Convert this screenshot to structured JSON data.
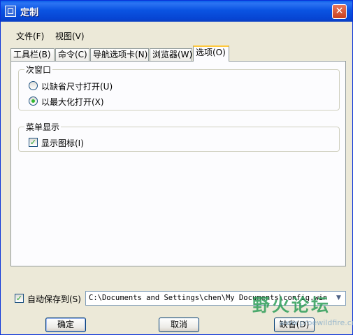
{
  "window": {
    "title": "定制",
    "close_label": "✕"
  },
  "menu": [
    "文件(F)",
    "视图(V)"
  ],
  "tabs": [
    "工具栏(B)",
    "命令(C)",
    "导航选项卡(N)",
    "浏览器(W)",
    "选项(O)"
  ],
  "active_tab": "选项(O)",
  "group_window": {
    "legend": "次窗口",
    "options": [
      "以缺省尺寸打开(U)",
      "以最大化打开(X)"
    ],
    "selected": "以最大化打开(X)"
  },
  "group_menu": {
    "legend": "菜单显示",
    "show_icons_label": "显示图标(I)",
    "show_icons_checked": true
  },
  "autosave": {
    "label": "自动保存到(S)",
    "checked": true,
    "path": "C:\\Documents and Settings\\chen\\My Documents\\config.win"
  },
  "buttons": {
    "ok": "确定",
    "cancel": "取消",
    "default": "缺省(D)"
  },
  "watermark": {
    "logo_text": "野火论坛",
    "url_text": "www.proewildfire.cn"
  },
  "colors": {
    "titlebar": "#0A5FE8",
    "accent_tab": "#FFC83C",
    "check": "#21A121",
    "radio_dot": "#2FB82F"
  }
}
